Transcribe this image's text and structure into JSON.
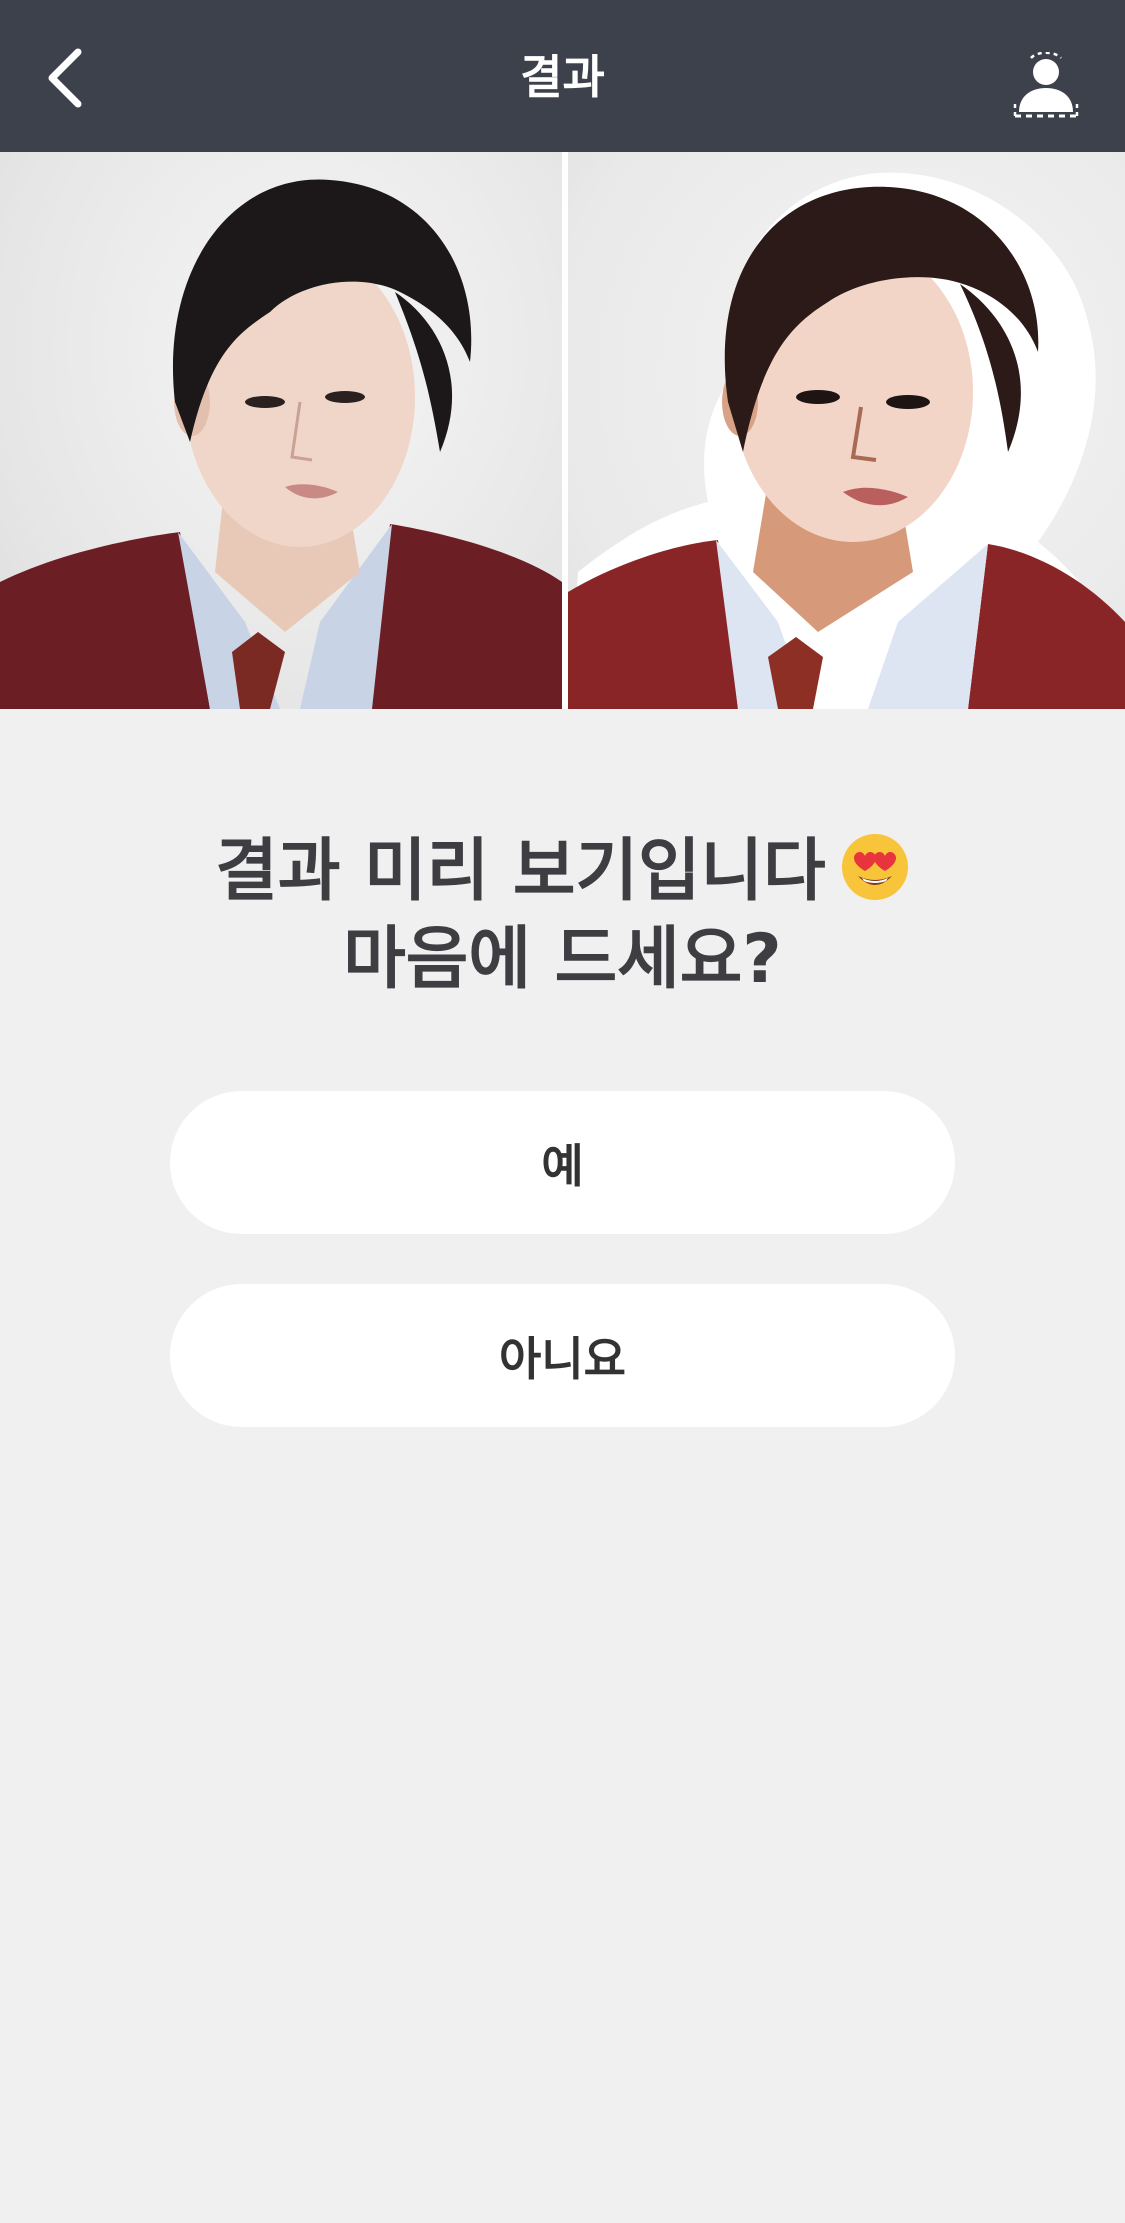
{
  "header": {
    "title": "결과",
    "back_icon": "chevron-left-icon",
    "profile_icon": "person-silhouette-icon"
  },
  "images": {
    "original_alt": "original photo",
    "cartoon_alt": "cartoon result"
  },
  "prompt": {
    "line1": "결과 미리 보기입니다",
    "emoji": "heart-eyes-emoji-icon",
    "line2": "마음에 드세요?"
  },
  "buttons": {
    "yes_label": "예",
    "no_label": "아니요"
  },
  "colors": {
    "header_bg": "#3d414c",
    "page_bg": "#f0f0f0",
    "button_bg": "#ffffff",
    "text_dark": "#3d3d42"
  }
}
